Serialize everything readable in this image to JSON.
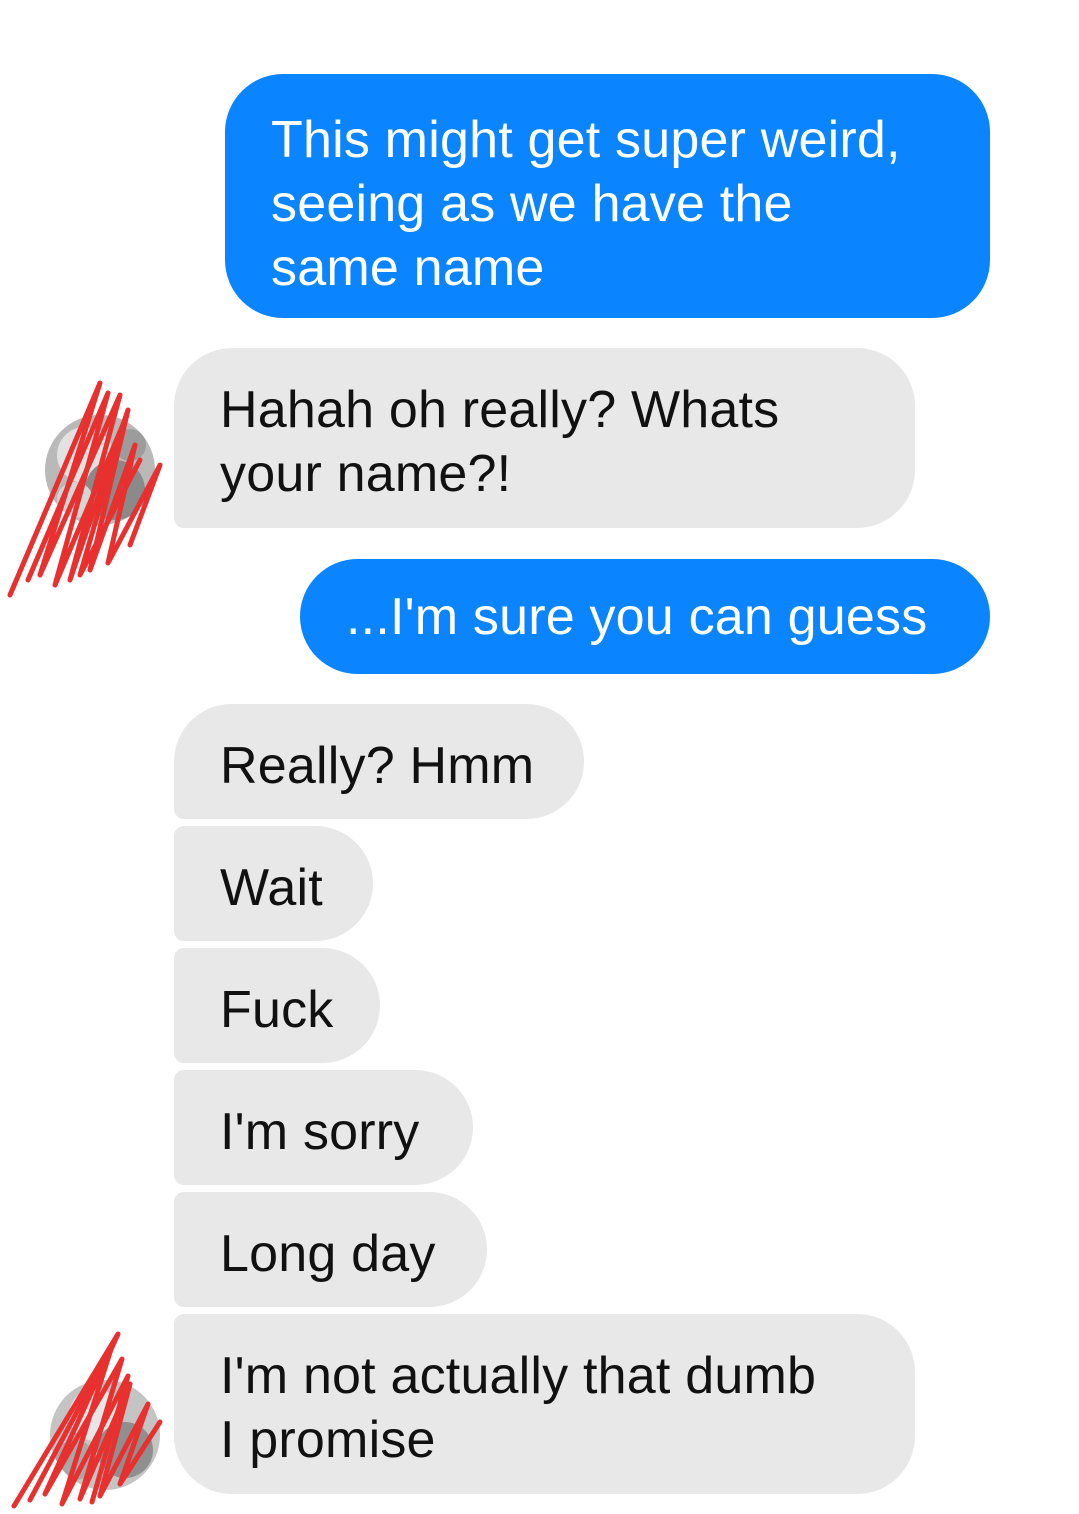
{
  "conversation": {
    "messages": [
      {
        "sender": "me",
        "text": "This might get super weird,\nseeing as we have the\nsame name"
      },
      {
        "sender": "them",
        "text": "Hahah oh really? Whats\nyour name?!"
      },
      {
        "sender": "me",
        "text": "...I'm sure you can guess"
      },
      {
        "sender": "them",
        "text": "Really? Hmm"
      },
      {
        "sender": "them",
        "text": "Wait"
      },
      {
        "sender": "them",
        "text": "Fuck"
      },
      {
        "sender": "them",
        "text": "I'm sorry"
      },
      {
        "sender": "them",
        "text": "Long day"
      },
      {
        "sender": "them",
        "text": "I'm not actually that dumb\nI promise"
      }
    ]
  },
  "colors": {
    "sent_bubble": "#0a84ff",
    "received_bubble": "#e8e8e8",
    "redaction_scribble": "#e8302e"
  }
}
